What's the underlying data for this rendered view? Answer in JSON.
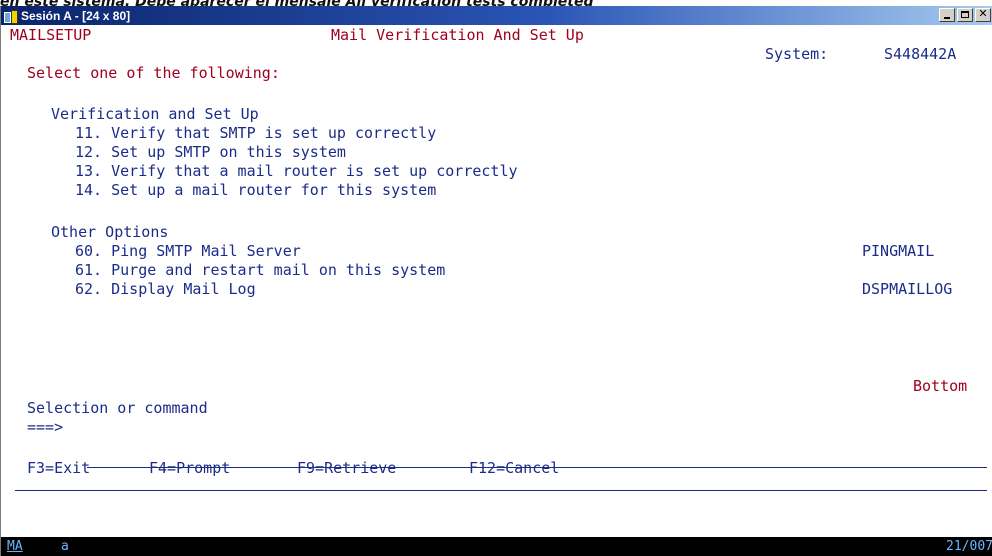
{
  "background_caption": "en este sistema. Debe aparecer el mensaje All verification tests completed",
  "window": {
    "title": "Sesión A - [24 x 80]"
  },
  "screen": {
    "program": "MAILSETUP",
    "title": "Mail Verification And Set Up",
    "system_label": "System:",
    "system_value": "S448442A",
    "instruction": "Select one of the following:",
    "groups": [
      {
        "heading": "Verification and Set Up",
        "options": [
          {
            "text": "11. Verify that SMTP is set up correctly",
            "command": ""
          },
          {
            "text": "12. Set up SMTP on this system",
            "command": ""
          },
          {
            "text": "13. Verify that a mail router is set up correctly",
            "command": ""
          },
          {
            "text": "14. Set up a mail router for this system",
            "command": ""
          }
        ]
      },
      {
        "heading": "Other Options",
        "options": [
          {
            "text": "60. Ping SMTP Mail Server",
            "command": "PINGMAIL"
          },
          {
            "text": "61. Purge and restart mail on this system",
            "command": ""
          },
          {
            "text": "62. Display Mail Log",
            "command": "DSPMAILLOG"
          }
        ]
      }
    ],
    "more_indicator": "Bottom",
    "selection_label": "Selection or command",
    "prompt": "===>",
    "command_value": "",
    "function_keys": [
      "F3=Exit",
      "F4=Prompt",
      "F9=Retrieve",
      "F12=Cancel"
    ]
  },
  "statusbar": {
    "mode": "MA",
    "indicator": "a",
    "cursor_position": "21/007"
  },
  "colors": {
    "field_red": "#a0001e",
    "text_blue": "#1a2c8a",
    "titlebar": "#0a246a"
  }
}
